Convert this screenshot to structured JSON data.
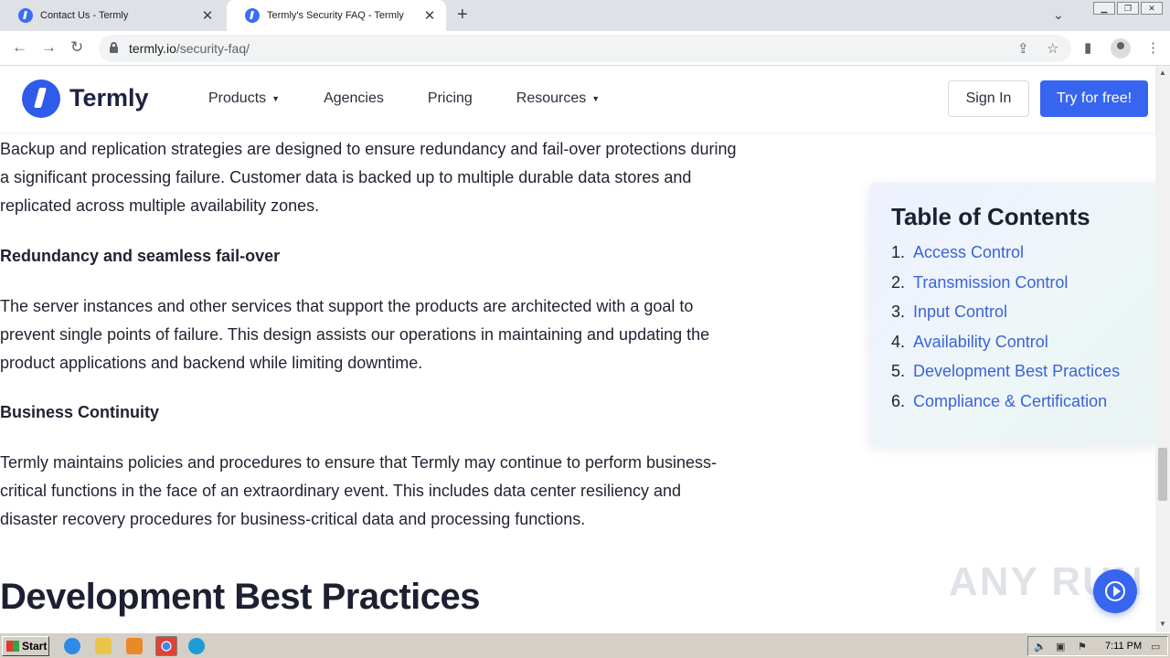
{
  "browser": {
    "tabs": [
      {
        "title": "Contact Us - Termly"
      },
      {
        "title": "Termly's Security FAQ - Termly"
      }
    ],
    "url_domain": "termly.io",
    "url_path": "/security-faq/"
  },
  "site": {
    "logo_text": "Termly",
    "nav": [
      {
        "label": "Products",
        "dropdown": true
      },
      {
        "label": "Agencies",
        "dropdown": false
      },
      {
        "label": "Pricing",
        "dropdown": false
      },
      {
        "label": "Resources",
        "dropdown": true
      }
    ],
    "signin_label": "Sign In",
    "try_label": "Try for free!"
  },
  "content": {
    "para1": "Backup and replication strategies are designed to ensure redundancy and fail-over protections during a significant processing failure. Customer data is backed up to multiple durable data stores and replicated across multiple availability zones.",
    "heading1": "Redundancy and seamless fail-over",
    "para2": "The server instances and other services that support the products are architected with a goal to prevent single points of failure. This design assists our operations in maintaining and updating the product applications and backend while limiting downtime.",
    "heading2": "Business Continuity",
    "para3": "Termly maintains policies and procedures to ensure that Termly may continue to perform business-critical functions in the face of an extraordinary event. This includes data center resiliency and disaster recovery procedures for business-critical data and processing functions.",
    "section_title": "Development Best Practices"
  },
  "toc": {
    "title": "Table of Contents",
    "items": [
      {
        "num": "1.",
        "label": "Access Control"
      },
      {
        "num": "2.",
        "label": "Transmission Control"
      },
      {
        "num": "3.",
        "label": "Input Control"
      },
      {
        "num": "4.",
        "label": "Availability Control"
      },
      {
        "num": "5.",
        "label": "Development Best Practices"
      },
      {
        "num": "6.",
        "label": "Compliance & Certification"
      }
    ]
  },
  "watermark": "ANY RUN",
  "taskbar": {
    "start_label": "Start",
    "clock": "7:11 PM"
  },
  "colors": {
    "brand": "#3765ef",
    "link": "#3a63d8"
  }
}
